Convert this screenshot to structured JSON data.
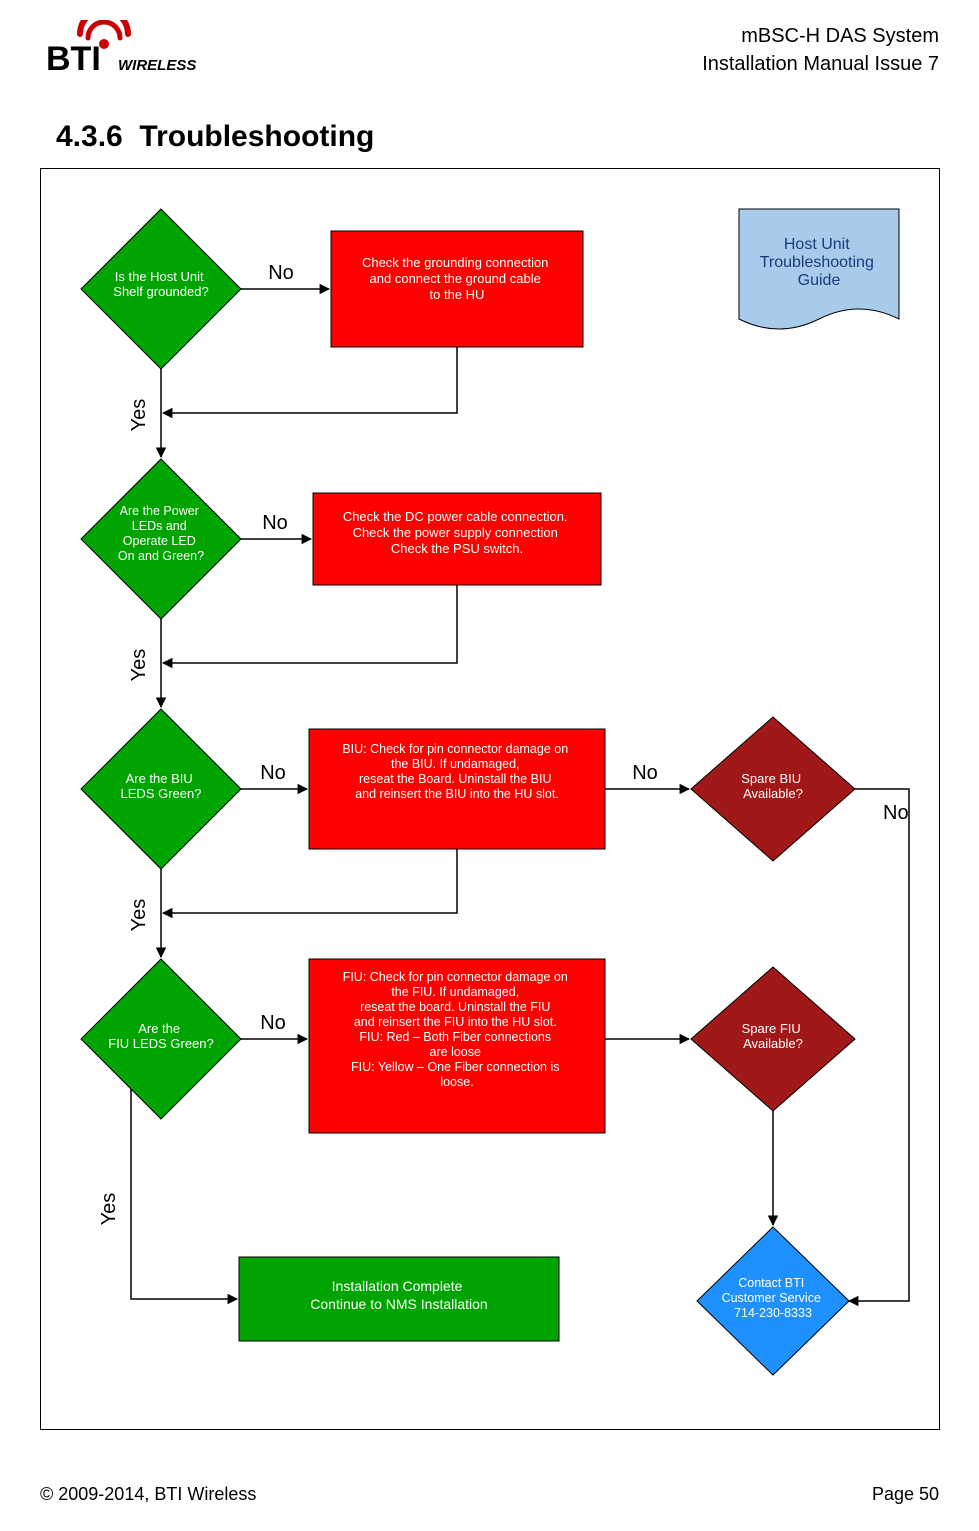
{
  "header": {
    "system": "mBSC-H DAS System",
    "manual": "Installation Manual Issue 7"
  },
  "logo": {
    "brand_main": "BTI",
    "brand_sub": "WIRELESS"
  },
  "section": {
    "number": "4.3.6",
    "title": "Troubleshooting"
  },
  "footer": {
    "copyright": "© 2009-2014, BTI Wireless",
    "page": "Page 50"
  },
  "chart_data": {
    "type": "flowchart",
    "title_note": "Host Unit Troubleshooting Guide",
    "nodes": [
      {
        "id": "d1",
        "type": "decision",
        "fill": "green",
        "text": "Is the Host Unit Shelf grounded?"
      },
      {
        "id": "a1",
        "type": "process",
        "fill": "red",
        "text": "Check the grounding connection and connect the ground cable to the HU"
      },
      {
        "id": "d2",
        "type": "decision",
        "fill": "green",
        "text": "Are the Power LEDs and Operate LED On and Green?"
      },
      {
        "id": "a2",
        "type": "process",
        "fill": "red",
        "text": "Check the DC power cable connection. Check the power supply connection Check the PSU switch."
      },
      {
        "id": "d3",
        "type": "decision",
        "fill": "green",
        "text": "Are the BIU LEDS Green?"
      },
      {
        "id": "a3",
        "type": "process",
        "fill": "red",
        "text": "BIU: Check for pin connector damage on the BIU. If undamaged, reseat the Board. Uninstall the BIU and reinsert the BIU into the HU slot."
      },
      {
        "id": "d3b",
        "type": "decision",
        "fill": "darkred",
        "text": "Spare BIU Available?"
      },
      {
        "id": "d4",
        "type": "decision",
        "fill": "green",
        "text": "Are the FIU LEDS Green?"
      },
      {
        "id": "a4",
        "type": "process",
        "fill": "red",
        "text": "FIU: Check for pin connector damage on the FIU. If undamaged, reseat the board. Uninstall the FIU and reinsert the FIU into the HU slot. FIU: Red – Both Fiber connections are loose FIU: Yellow – One Fiber connection is loose."
      },
      {
        "id": "d4b",
        "type": "decision",
        "fill": "darkred",
        "text": "Spare FIU Available?"
      },
      {
        "id": "ok",
        "type": "process",
        "fill": "green",
        "text": "Installation Complete Continue to NMS Installation"
      },
      {
        "id": "cs",
        "type": "decision",
        "fill": "blue",
        "text": "Contact BTI Customer Service 714-230-8333"
      }
    ],
    "edges": [
      {
        "from": "d1",
        "to": "a1",
        "label": "No"
      },
      {
        "from": "d1",
        "to": "d2",
        "label": "Yes"
      },
      {
        "from": "a1",
        "to": "d2",
        "label": ""
      },
      {
        "from": "d2",
        "to": "a2",
        "label": "No"
      },
      {
        "from": "d2",
        "to": "d3",
        "label": "Yes"
      },
      {
        "from": "a2",
        "to": "d3",
        "label": ""
      },
      {
        "from": "d3",
        "to": "a3",
        "label": "No"
      },
      {
        "from": "a3",
        "to": "d3b",
        "label": "No"
      },
      {
        "from": "d3",
        "to": "d4",
        "label": "Yes"
      },
      {
        "from": "a3",
        "to": "d4",
        "label": ""
      },
      {
        "from": "d3b",
        "to": "cs",
        "label": "No"
      },
      {
        "from": "d4",
        "to": "a4",
        "label": "No"
      },
      {
        "from": "a4",
        "to": "d4b",
        "label": ""
      },
      {
        "from": "d4",
        "to": "ok",
        "label": "Yes"
      },
      {
        "from": "d4b",
        "to": "cs",
        "label": ""
      }
    ]
  }
}
